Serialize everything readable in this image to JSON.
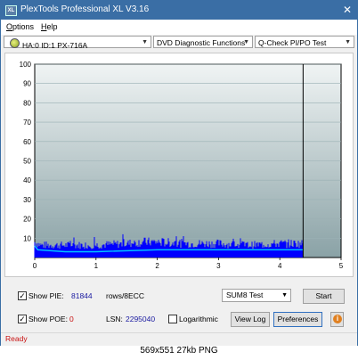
{
  "window": {
    "title": "PlexTools Professional XL V3.16",
    "icon_text": "XL"
  },
  "menu": {
    "items": [
      {
        "label": "Options",
        "accel": "O"
      },
      {
        "label": "Help",
        "accel": "H"
      }
    ]
  },
  "toolbar": {
    "drive": "HA:0 ID:1  PX-716A",
    "function": "DVD Diagnostic Functions",
    "test": "Q-Check PI/PO Test"
  },
  "chart_data": {
    "type": "area",
    "xlim": [
      0,
      5
    ],
    "ylim": [
      0,
      100
    ],
    "x_ticks": [
      "0",
      "1",
      "2",
      "3",
      "4",
      "5"
    ],
    "y_ticks": [
      "10",
      "20",
      "30",
      "40",
      "50",
      "60",
      "70",
      "80",
      "90",
      "100"
    ],
    "end_marker_x": 4.38,
    "series": [
      {
        "name": "PIE",
        "color": "#0000ff",
        "x": [
          0,
          0.1,
          0.25,
          0.5,
          1.0,
          1.5,
          1.75,
          2.0,
          2.5,
          3.0,
          3.5,
          4.0,
          4.38
        ],
        "y": [
          10,
          8,
          8,
          8,
          8,
          9,
          10,
          10,
          9,
          9,
          8,
          9,
          9
        ]
      },
      {
        "name": "PIE avg",
        "color": "#00c8ff",
        "x": [
          0,
          0.05,
          0.5,
          1.0,
          2.0,
          3.0,
          4.0,
          4.38
        ],
        "y": [
          6,
          4,
          3,
          3,
          4,
          4,
          4,
          4
        ]
      }
    ],
    "background_top": "#f0f4f4",
    "background_bottom": "#8aa2a6"
  },
  "controls": {
    "show_pie_label": "Show PIE:",
    "pie_value": "81844",
    "pie_unit": "rows/8ECC",
    "show_poe_label": "Show POE:",
    "poe_value": "0",
    "lsn_label": "LSN:",
    "lsn_value": "2295040",
    "logarithmic_label": "Logarithmic",
    "sum_select": "SUM8 Test",
    "start_label": "Start",
    "view_log_label": "View Log",
    "preferences_label": "Preferences",
    "info_label": "i"
  },
  "status": {
    "text": "Ready"
  },
  "caption": {
    "text": "569x551  27kb  PNG"
  }
}
